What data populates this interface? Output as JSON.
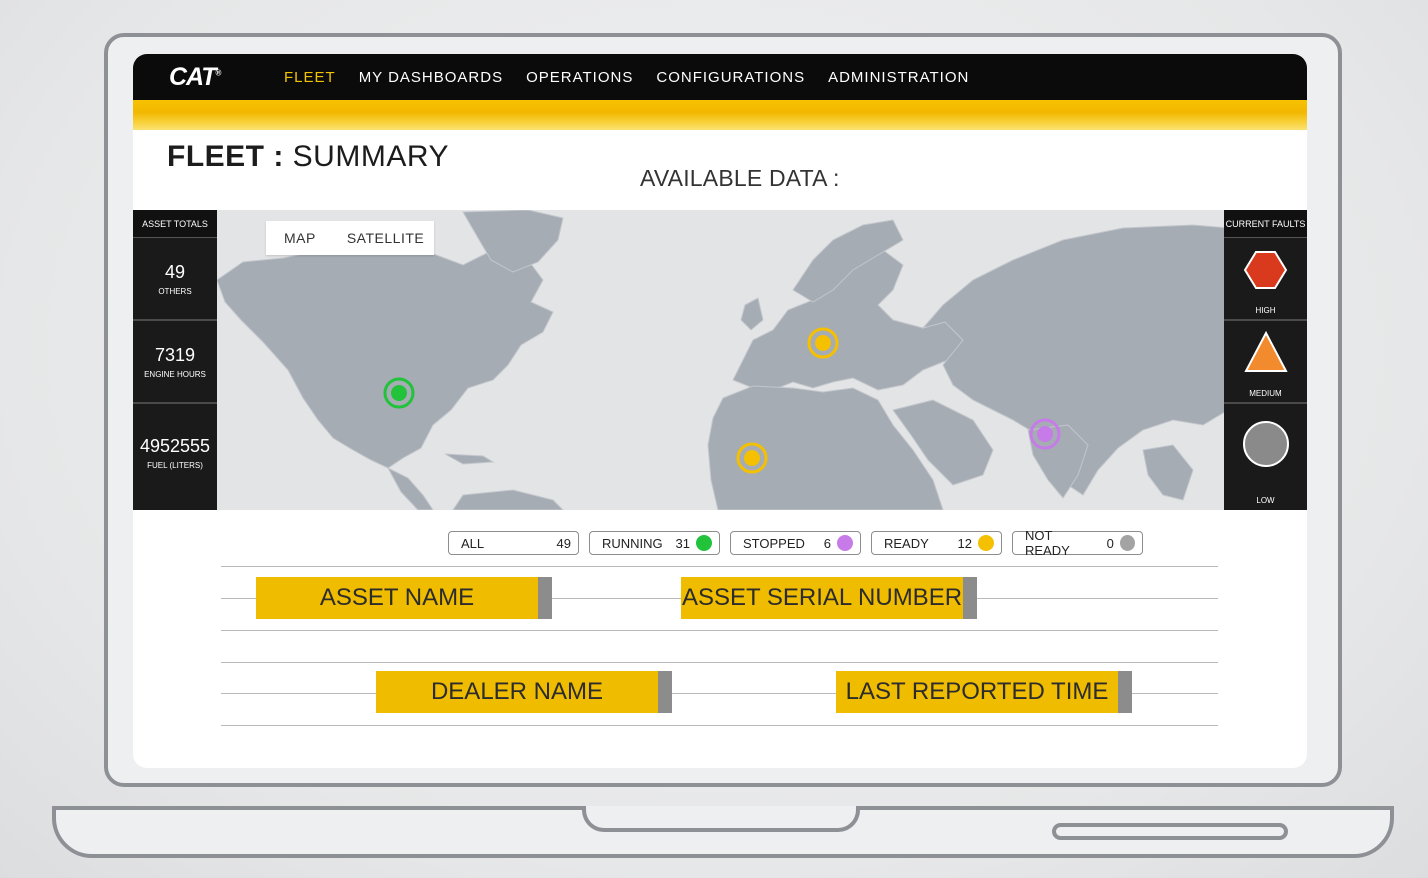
{
  "brand": {
    "logo": "CAT",
    "mark": "®"
  },
  "nav": {
    "items": [
      {
        "label": "FLEET",
        "active": true
      },
      {
        "label": "MY DASHBOARDS",
        "active": false
      },
      {
        "label": "OPERATIONS",
        "active": false
      },
      {
        "label": "CONFIGURATIONS",
        "active": false
      },
      {
        "label": "ADMINISTRATION",
        "active": false
      }
    ]
  },
  "page": {
    "title_bold": "FLEET :",
    "title_rest": " SUMMARY",
    "available_data": "AVAILABLE DATA :"
  },
  "map": {
    "toggle": {
      "map": "MAP",
      "satellite": "SATELLITE"
    }
  },
  "asset_totals": {
    "header": "ASSET TOTALS",
    "stats": [
      {
        "value": "49",
        "label": "OTHERS"
      },
      {
        "value": "7319",
        "label": "ENGINE HOURS"
      },
      {
        "value": "4952555",
        "label": "FUEL (LITERS)"
      }
    ]
  },
  "current_faults": {
    "header": "CURRENT FAULTS",
    "levels": [
      {
        "label": "HIGH",
        "color": "#d93a1e"
      },
      {
        "label": "MEDIUM",
        "color": "#f28a2e"
      },
      {
        "label": "LOW",
        "color": "#8a8a8a"
      }
    ]
  },
  "filters": [
    {
      "label": "ALL",
      "count": "49",
      "color": null
    },
    {
      "label": "RUNNING",
      "count": "31",
      "color": "#22c23b"
    },
    {
      "label": "STOPPED",
      "count": "6",
      "color": "#c77be8"
    },
    {
      "label": "READY",
      "count": "12",
      "color": "#f5c000"
    },
    {
      "label": "NOT READY",
      "count": "0",
      "color": "#a3a3a3"
    }
  ],
  "fields": {
    "asset_name": "ASSET NAME",
    "asset_serial": "ASSET SERIAL NUMBER",
    "dealer_name": "DEALER NAME",
    "last_reported": "LAST REPORTED TIME"
  },
  "colors": {
    "accent": "#f5c400",
    "field": "#f0bc00",
    "nav_bg": "#0b0b0b",
    "land": "#a6acb4",
    "ocean": "#e3e4e6"
  }
}
